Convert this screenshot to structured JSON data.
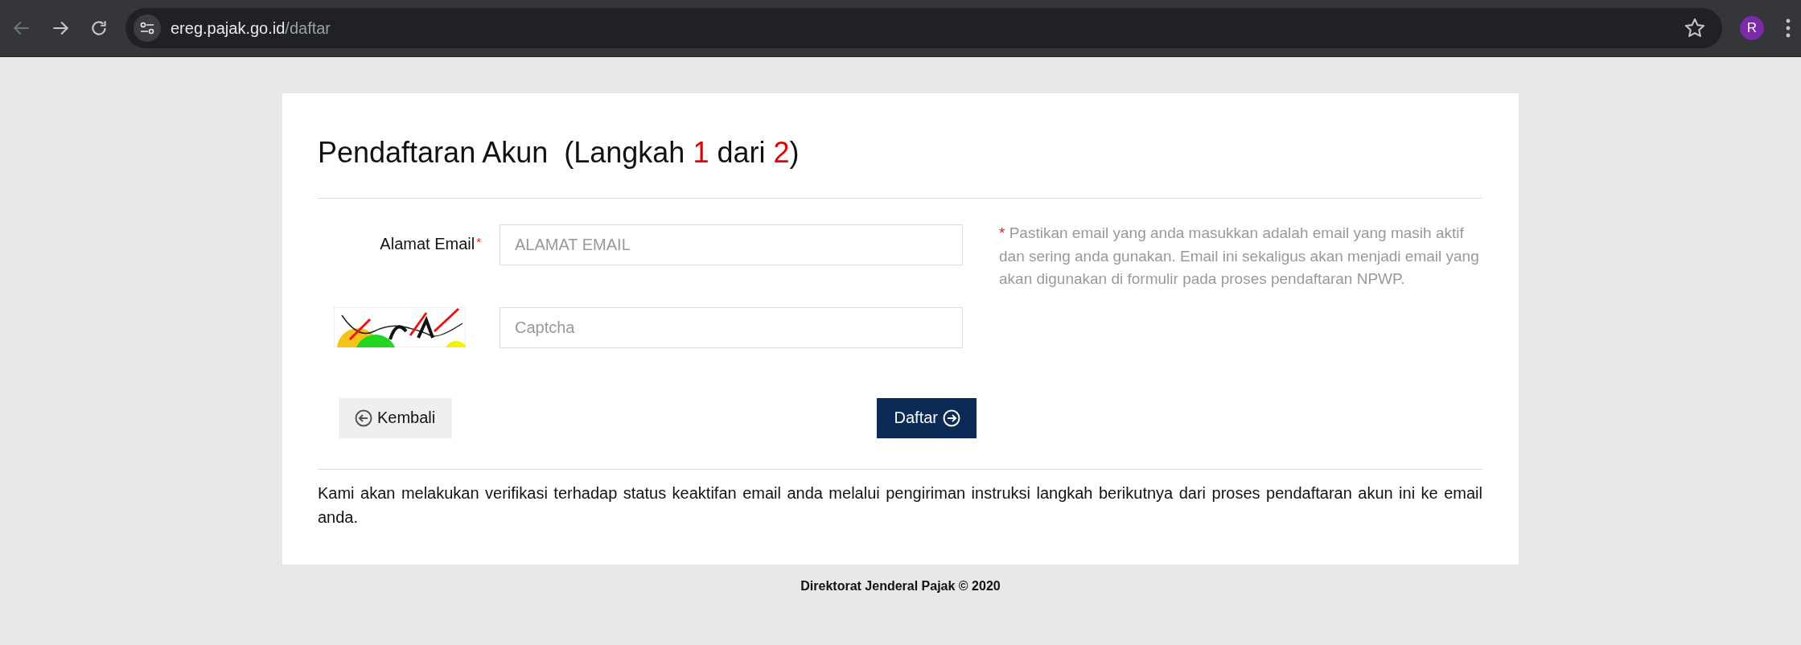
{
  "browser": {
    "url_host": "ereg.pajak.go.id",
    "url_path": "/daftar",
    "profile_initial": "R",
    "bookmarked": false
  },
  "form": {
    "title": "Pendaftaran Akun",
    "step_prefix": "(Langkah",
    "step_current": "1",
    "step_middle": "dari",
    "step_total": "2",
    "step_suffix": ")",
    "email_label": "Alamat Email",
    "required_mark": "*",
    "email_placeholder": "ALAMAT EMAIL",
    "help_mark": "*",
    "help_text": "Pastikan email yang anda masukkan adalah email yang masih aktif dan sering anda gunakan. Email ini sekaligus akan menjadi email yang akan digunakan di formulir pada proses pendaftaran NPWP.",
    "captcha_placeholder": "Captcha",
    "back_button": "Kembali",
    "submit_button": "Daftar",
    "note": "Kami akan melakukan verifikasi terhadap status keaktifan email anda melalui pengiriman instruksi langkah berikutnya dari proses pendaftaran akun ini ke email anda."
  },
  "footer": "Direktorat Jenderal Pajak © 2020"
}
